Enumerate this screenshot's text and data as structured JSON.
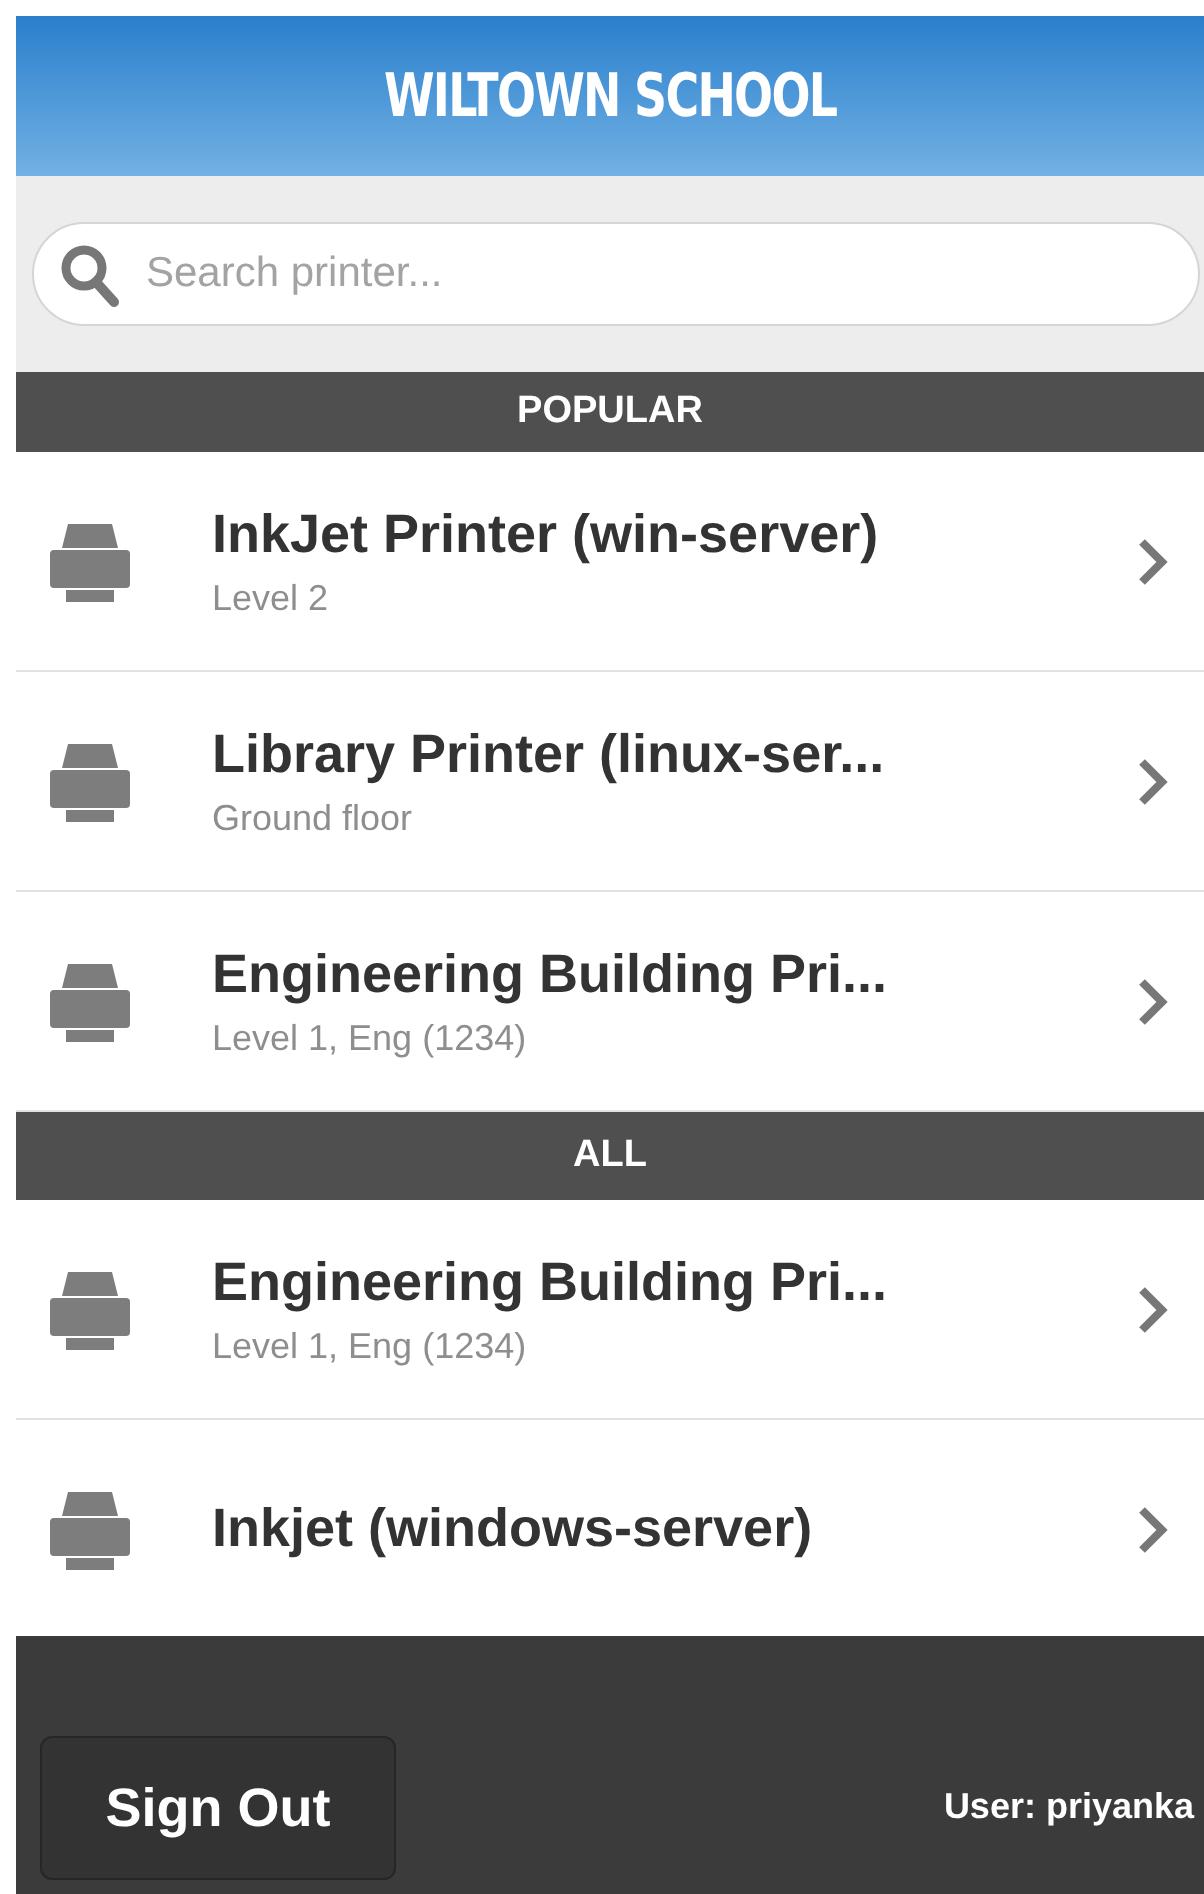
{
  "header": {
    "title": "WILTOWN SCHOOL"
  },
  "search": {
    "placeholder": "Search printer..."
  },
  "sections": [
    {
      "title": "POPULAR",
      "items": [
        {
          "name": "InkJet Printer (win-server)",
          "location": "Level 2"
        },
        {
          "name": "Library Printer (linux-ser...",
          "location": "Ground floor"
        },
        {
          "name": "Engineering Building Pri...",
          "location": "Level 1, Eng (1234)"
        }
      ]
    },
    {
      "title": "ALL",
      "items": [
        {
          "name": "Engineering Building Pri...",
          "location": "Level 1, Eng (1234)"
        },
        {
          "name": "Inkjet (windows-server)"
        }
      ]
    }
  ],
  "footer": {
    "sign_out": "Sign Out",
    "user": "User: priyanka"
  }
}
